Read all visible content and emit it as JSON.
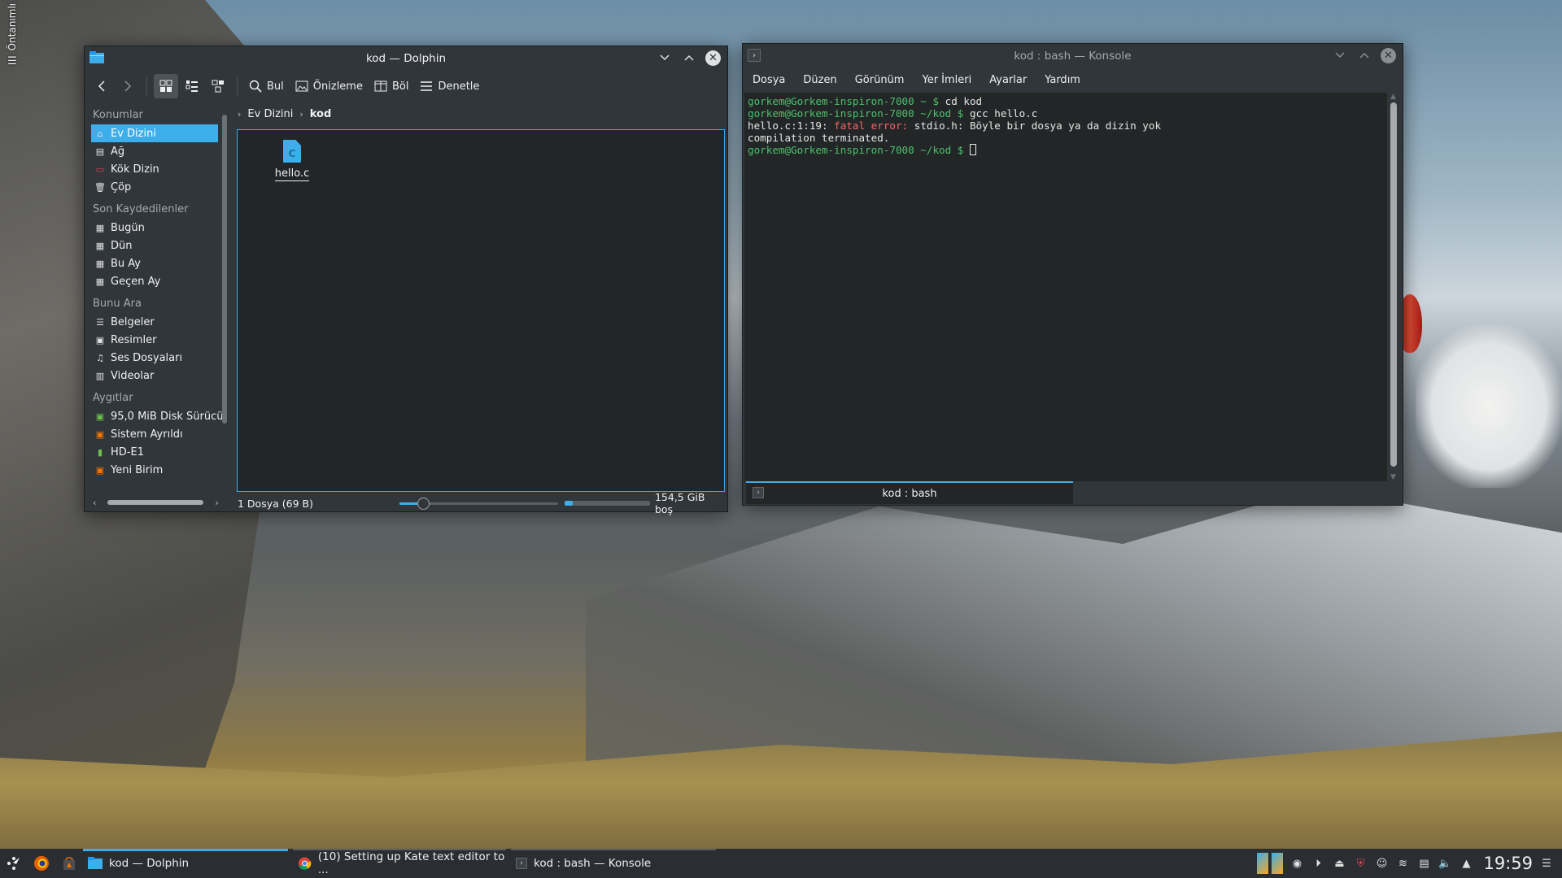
{
  "desktop": {
    "toolbox_label": "Öntanımlı"
  },
  "dolphin": {
    "title": "kod — Dolphin",
    "toolbar": {
      "find": "Bul",
      "preview": "Önizleme",
      "split": "Böl",
      "control": "Denetle"
    },
    "places": {
      "sections": {
        "places": "Konumlar",
        "recent": "Son Kaydedilenler",
        "search": "Bunu Ara",
        "devices": "Aygıtlar"
      },
      "places_items": [
        "Ev Dizini",
        "Ağ",
        "Kök Dizin",
        "Çöp"
      ],
      "recent_items": [
        "Bugün",
        "Dün",
        "Bu Ay",
        "Geçen Ay"
      ],
      "search_items": [
        "Belgeler",
        "Resimler",
        "Ses Dosyaları",
        "Videolar"
      ],
      "device_items": [
        "95,0 MiB Disk Sürücü",
        "Sistem Ayrıldı",
        "HD-E1",
        "Yeni Birim"
      ]
    },
    "breadcrumb": {
      "home": "Ev Dizini",
      "current": "kod"
    },
    "files": [
      {
        "name": "hello.c",
        "icon_glyph": "C"
      }
    ],
    "status": {
      "text": "1 Dosya (69 B)",
      "zoom_fraction": 0.15,
      "disk_used_fraction": 0.1,
      "free_space": "154,5 GiB boş"
    }
  },
  "konsole": {
    "title": "kod : bash — Konsole",
    "menu": [
      "Dosya",
      "Düzen",
      "Görünüm",
      "Yer İmleri",
      "Ayarlar",
      "Yardım"
    ],
    "lines": [
      {
        "prompt": "gorkem@Gorkem-inspiron-7000 ~ $",
        "text": " cd kod"
      },
      {
        "prompt": "gorkem@Gorkem-inspiron-7000 ~/kod $",
        "text": " gcc hello.c"
      },
      {
        "prefix": "hello.c:1:19: ",
        "err": "fatal error:",
        "text": " stdio.h: Böyle bir dosya ya da dizin yok"
      },
      {
        "text": "compilation terminated."
      },
      {
        "prompt": "gorkem@Gorkem-inspiron-7000 ~/kod $",
        "text": " "
      }
    ],
    "tab_label": "kod : bash"
  },
  "taskbar": {
    "tasks": [
      {
        "label": "kod — Dolphin",
        "state": "active"
      },
      {
        "label": "(10) Setting up Kate text editor to ...",
        "state": "inactive"
      },
      {
        "label": "kod : bash — Konsole",
        "state": "inactive"
      }
    ],
    "clock": "19:59"
  },
  "colors": {
    "accent": "#3daee9",
    "window_bg": "#31363b",
    "view_bg": "#232629",
    "prompt_green": "#4fbf6e",
    "error_red": "#ed6b6b"
  }
}
